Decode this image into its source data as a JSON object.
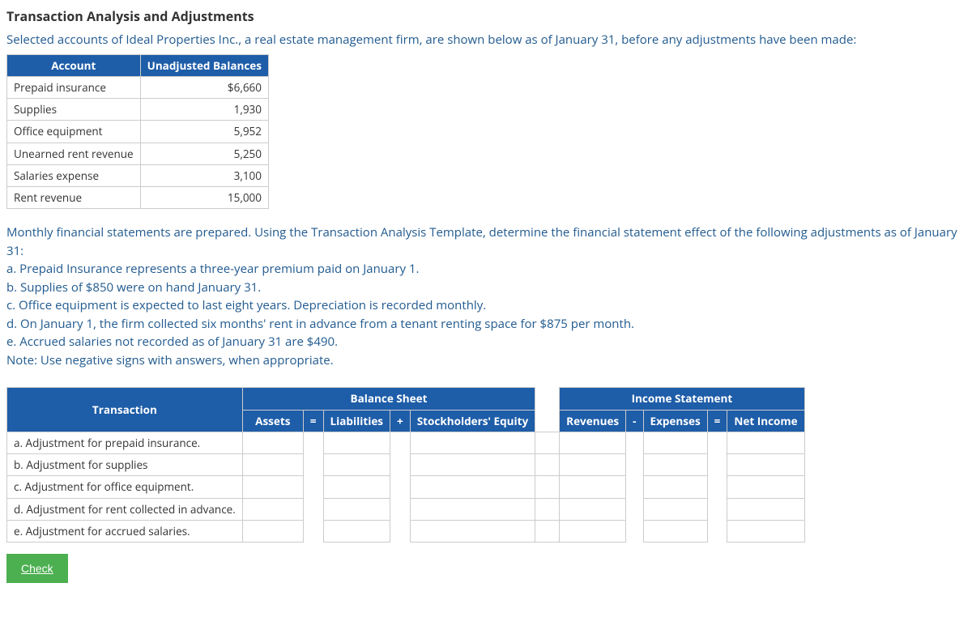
{
  "title": "Transaction Analysis and Adjustments",
  "intro": "Selected accounts of Ideal Properties Inc., a real estate management firm, are shown below as of January 31, before any adjustments have been made:",
  "accounts_table": {
    "headers": {
      "col1": "Account",
      "col2": "Unadjusted Balances"
    },
    "rows": [
      {
        "name": "Prepaid insurance",
        "value": "$6,660"
      },
      {
        "name": "Supplies",
        "value": "1,930"
      },
      {
        "name": "Office equipment",
        "value": "5,952"
      },
      {
        "name": "Unearned rent revenue",
        "value": "5,250"
      },
      {
        "name": "Salaries expense",
        "value": "3,100"
      },
      {
        "name": "Rent revenue",
        "value": "15,000"
      }
    ]
  },
  "instructions": {
    "lead": "Monthly financial statements are prepared. Using the Transaction Analysis Template, determine the financial statement effect of the following adjustments as of January 31:",
    "items": [
      "a. Prepaid Insurance represents a three-year premium paid on January 1.",
      "b. Supplies of $850 were on hand January 31.",
      "c. Office equipment is expected to last eight years. Depreciation is recorded monthly.",
      "d. On January 1, the firm collected six months' rent in advance from a tenant renting space for $875 per month.",
      "e. Accrued salaries not recorded as of January 31 are $490."
    ],
    "note": "Note: Use negative signs with answers, when appropriate."
  },
  "adj_table": {
    "group1": "Balance Sheet",
    "group2": "Income Statement",
    "cols": {
      "transaction": "Transaction",
      "assets": "Assets",
      "eq1": "=",
      "liabilities": "Liabilities",
      "plus": "+",
      "equity": "Stockholders' Equity",
      "revenues": "Revenues",
      "minus": "-",
      "expenses": "Expenses",
      "eq2": "=",
      "netincome": "Net Income"
    },
    "rows": [
      "a. Adjustment for prepaid insurance.",
      "b. Adjustment for supplies",
      "c. Adjustment for office equipment.",
      "d. Adjustment for rent collected in advance.",
      "e. Adjustment for accrued salaries."
    ]
  },
  "check_label": "Check"
}
